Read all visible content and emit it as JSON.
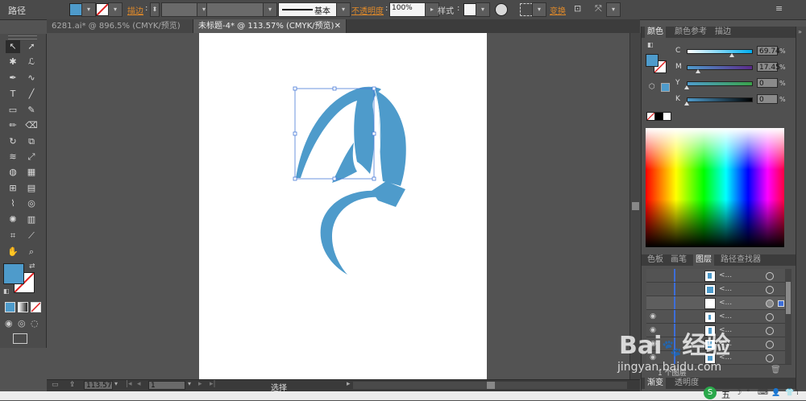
{
  "control_bar": {
    "object_type": "路径",
    "fill_color": "#4e9bcb",
    "stroke_label": "描边",
    "stroke_profile": "基本",
    "opacity_label": "不透明度",
    "opacity_value": "100%",
    "style_label": "样式",
    "transform_label": "变换"
  },
  "tabs": [
    {
      "label": "6281.ai* @ 896.5% (CMYK/预览)",
      "active": false
    },
    {
      "label": "未标题-4* @ 113.57% (CMYK/预览)",
      "active": true
    }
  ],
  "status_bar": {
    "zoom": "113.57",
    "artboard_number": "1",
    "selection_label": "选择"
  },
  "color_panel": {
    "tabs": [
      "颜色",
      "颜色参考",
      "描边"
    ],
    "active_tab": "颜色",
    "sliders": [
      {
        "name": "C",
        "value": "69.74",
        "level": 0.6974
      },
      {
        "name": "M",
        "value": "17.45",
        "level": 0.1745
      },
      {
        "name": "Y",
        "value": "0",
        "level": 0
      },
      {
        "name": "K",
        "value": "0",
        "level": 0
      }
    ],
    "percent_sign": "%",
    "current_color": "#4e9bcb"
  },
  "layers_panel": {
    "tabs": [
      "色板",
      "画笔",
      "图层",
      "路径查找器"
    ],
    "active_tab": "图层",
    "rows": [
      {
        "name": "<...",
        "visible": false,
        "targeted": false
      },
      {
        "name": "<...",
        "visible": false,
        "targeted": false
      },
      {
        "name": "<...",
        "visible": true,
        "targeted": true
      },
      {
        "name": "<...",
        "visible": true,
        "targeted": false
      },
      {
        "name": "<...",
        "visible": true,
        "targeted": false
      },
      {
        "name": "<...",
        "visible": true,
        "targeted": false
      },
      {
        "name": "<...",
        "visible": true,
        "targeted": false
      }
    ],
    "footer_label": "1 个图层"
  },
  "bottom_tabs": [
    "渐变",
    "透明度"
  ],
  "watermark": {
    "brand": "Bai",
    "brand_suffix": "经验",
    "url": "jingyan.baidu.com"
  },
  "taskbar": {
    "ime_label": "五"
  },
  "artwork_color": "#4e9bcb"
}
